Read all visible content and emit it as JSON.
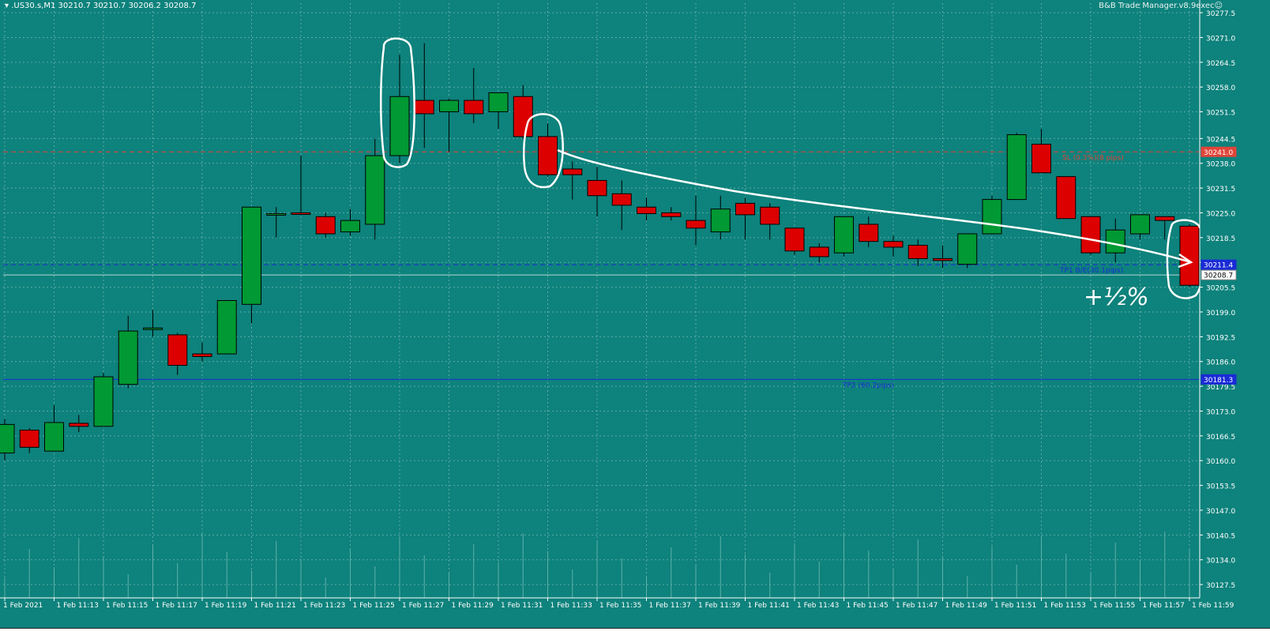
{
  "header": {
    "symbol_text": "▾ .US30.s,M1  30210.7 30210.7 30206.2 30208.7",
    "trade_manager": "B&B Trade Manager.v8.9exec☺"
  },
  "colors": {
    "background": "#0e827c",
    "grid": "#7fbcb8",
    "bull": "#009933",
    "bear": "#dd0000",
    "wick": "#000000",
    "sl_line": "#e0453a",
    "tp_line": "#1a2bd6",
    "annotation": "#ffffff"
  },
  "levels": {
    "sl": {
      "price": 30241.0,
      "tag": "30241.0",
      "text": "SL (0.3%)(8 pips)"
    },
    "tp1": {
      "price": 30211.4,
      "tag": "30211.4",
      "text": "TP1 B/E(30.1pips)"
    },
    "current": {
      "price": 30208.7,
      "tag": "30208.7"
    },
    "tp2": {
      "price": 30181.3,
      "tag": "30181.3",
      "text": "TP2 (60.2pips)"
    }
  },
  "annotation_text": "+½%",
  "chart_data": {
    "type": "candlestick",
    "title": "",
    "symbol": ".US30.s",
    "timeframe": "M1",
    "xlabel": "",
    "ylabel": "",
    "ylim": [
      30124.0,
      30280.0
    ],
    "y_ticks": [
      "30277.5",
      "30271.0",
      "30264.5",
      "30258.0",
      "30251.5",
      "30244.5",
      "30238.0",
      "30231.5",
      "30225.0",
      "30218.5",
      "30212.0",
      "30205.5",
      "30199.0",
      "30192.5",
      "30186.0",
      "30179.5",
      "30173.0",
      "30166.5",
      "30160.0",
      "30153.5",
      "30147.0",
      "30140.5",
      "30134.0",
      "30127.5"
    ],
    "x_ticks": [
      "1 Feb 2021",
      "1 Feb 11:13",
      "1 Feb 11:15",
      "1 Feb 11:17",
      "1 Feb 11:19",
      "1 Feb 11:21",
      "1 Feb 11:23",
      "1 Feb 11:25",
      "1 Feb 11:27",
      "1 Feb 11:29",
      "1 Feb 11:31",
      "1 Feb 11:33",
      "1 Feb 11:35",
      "1 Feb 11:37",
      "1 Feb 11:39",
      "1 Feb 11:41",
      "1 Feb 11:43",
      "1 Feb 11:45",
      "1 Feb 11:47",
      "1 Feb 11:49",
      "1 Feb 11:51",
      "1 Feb 11:53",
      "1 Feb 11:55",
      "1 Feb 11:57",
      "1 Feb 11:59"
    ],
    "grid": true,
    "candles": [
      {
        "o": 30162.0,
        "h": 30171.0,
        "l": 30160.0,
        "c": 30169.5
      },
      {
        "o": 30168.0,
        "h": 30168.5,
        "l": 30162.0,
        "c": 30163.5
      },
      {
        "o": 30162.5,
        "h": 30174.5,
        "l": 30162.5,
        "c": 30170.0
      },
      {
        "o": 30169.8,
        "h": 30172.0,
        "l": 30167.5,
        "c": 30169.0
      },
      {
        "o": 30169.0,
        "h": 30183.0,
        "l": 30169.0,
        "c": 30182.0
      },
      {
        "o": 30180.0,
        "h": 30198.0,
        "l": 30179.0,
        "c": 30194.0
      },
      {
        "o": 30194.5,
        "h": 30199.5,
        "l": 30192.5,
        "c": 30194.8
      },
      {
        "o": 30193.0,
        "h": 30193.5,
        "l": 30182.5,
        "c": 30185.0
      },
      {
        "o": 30188.0,
        "h": 30191.0,
        "l": 30186.0,
        "c": 30187.3
      },
      {
        "o": 30188.0,
        "h": 30202.0,
        "l": 30188.0,
        "c": 30202.0
      },
      {
        "o": 30201.0,
        "h": 30226.5,
        "l": 30196.0,
        "c": 30226.5
      },
      {
        "o": 30224.5,
        "h": 30226.5,
        "l": 30218.5,
        "c": 30224.8
      },
      {
        "o": 30225.0,
        "h": 30240.0,
        "l": 30225.0,
        "c": 30224.8
      },
      {
        "o": 30224.0,
        "h": 30225.0,
        "l": 30218.5,
        "c": 30219.5
      },
      {
        "o": 30220.0,
        "h": 30226.0,
        "l": 30219.0,
        "c": 30223.0
      },
      {
        "o": 30222.0,
        "h": 30244.5,
        "l": 30218.0,
        "c": 30240.0
      },
      {
        "o": 30240.0,
        "h": 30266.5,
        "l": 30238.0,
        "c": 30255.5
      },
      {
        "o": 30254.5,
        "h": 30269.5,
        "l": 30242.0,
        "c": 30251.0
      },
      {
        "o": 30251.5,
        "h": 30255.0,
        "l": 30241.0,
        "c": 30254.5
      },
      {
        "o": 30254.5,
        "h": 30263.0,
        "l": 30248.5,
        "c": 30251.0
      },
      {
        "o": 30251.5,
        "h": 30256.5,
        "l": 30247.0,
        "c": 30256.5
      },
      {
        "o": 30255.5,
        "h": 30258.5,
        "l": 30244.5,
        "c": 30245.0
      },
      {
        "o": 30245.0,
        "h": 30248.5,
        "l": 30234.5,
        "c": 30235.0
      },
      {
        "o": 30236.5,
        "h": 30238.5,
        "l": 30228.5,
        "c": 30235.0
      },
      {
        "o": 30233.5,
        "h": 30237.0,
        "l": 30224.0,
        "c": 30229.5
      },
      {
        "o": 30230.0,
        "h": 30233.5,
        "l": 30220.5,
        "c": 30227.0
      },
      {
        "o": 30226.5,
        "h": 30229.0,
        "l": 30223.0,
        "c": 30224.8
      },
      {
        "o": 30225.0,
        "h": 30226.5,
        "l": 30223.0,
        "c": 30224.0
      },
      {
        "o": 30223.0,
        "h": 30229.5,
        "l": 30216.5,
        "c": 30221.0
      },
      {
        "o": 30220.0,
        "h": 30229.5,
        "l": 30218.0,
        "c": 30226.0
      },
      {
        "o": 30227.5,
        "h": 30229.0,
        "l": 30218.0,
        "c": 30224.5
      },
      {
        "o": 30226.5,
        "h": 30227.5,
        "l": 30218.0,
        "c": 30222.0
      },
      {
        "o": 30221.0,
        "h": 30221.0,
        "l": 30214.0,
        "c": 30215.0
      },
      {
        "o": 30216.0,
        "h": 30217.0,
        "l": 30212.0,
        "c": 30213.5
      },
      {
        "o": 30214.5,
        "h": 30224.0,
        "l": 30213.5,
        "c": 30224.0
      },
      {
        "o": 30222.0,
        "h": 30224.0,
        "l": 30216.0,
        "c": 30217.5
      },
      {
        "o": 30217.5,
        "h": 30219.0,
        "l": 30213.5,
        "c": 30216.0
      },
      {
        "o": 30216.5,
        "h": 30218.0,
        "l": 30211.0,
        "c": 30213.0
      },
      {
        "o": 30213.0,
        "h": 30216.5,
        "l": 30210.5,
        "c": 30212.5
      },
      {
        "o": 30211.5,
        "h": 30218.5,
        "l": 30210.5,
        "c": 30219.5
      },
      {
        "o": 30219.5,
        "h": 30229.5,
        "l": 30219.5,
        "c": 30228.5
      },
      {
        "o": 30228.5,
        "h": 30246.0,
        "l": 30228.5,
        "c": 30245.5
      },
      {
        "o": 30243.0,
        "h": 30247.0,
        "l": 30235.5,
        "c": 30235.5
      },
      {
        "o": 30234.5,
        "h": 30234.5,
        "l": 30223.5,
        "c": 30223.5
      },
      {
        "o": 30224.0,
        "h": 30224.0,
        "l": 30214.0,
        "c": 30214.5
      },
      {
        "o": 30214.5,
        "h": 30223.5,
        "l": 30212.0,
        "c": 30220.5
      },
      {
        "o": 30219.5,
        "h": 30224.0,
        "l": 30218.0,
        "c": 30224.5
      },
      {
        "o": 30224.0,
        "h": 30224.0,
        "l": 30218.0,
        "c": 30223.0
      },
      {
        "o": 30221.5,
        "h": 30222.0,
        "l": 30205.5,
        "c": 30206.0
      }
    ]
  }
}
